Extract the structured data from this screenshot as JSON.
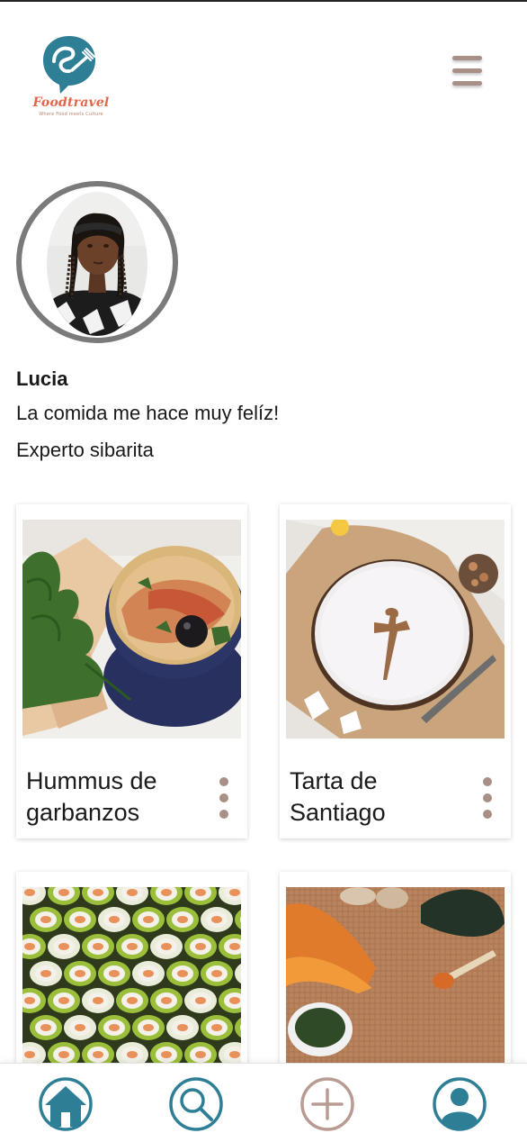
{
  "app": {
    "logo_name": "Foodtravel",
    "logo_tagline": "Where Food meets Culture"
  },
  "header": {
    "menu_icon": "hamburger-menu-icon"
  },
  "profile": {
    "name": "Lucia",
    "bio": "La comida me hace muy felíz!",
    "title": "Experto sibarita"
  },
  "recipes": [
    {
      "title": "Hummus de garbanzos",
      "image": "hummus-photo"
    },
    {
      "title": "Tarta de Santiago",
      "image": "tarta-de-santiago-photo"
    },
    {
      "title": "",
      "image": "sushi-photo"
    },
    {
      "title": "",
      "image": "lentil-soup-photo"
    }
  ],
  "bottom_nav": {
    "items": [
      {
        "icon": "home-icon",
        "active": true
      },
      {
        "icon": "search-icon",
        "active": false
      },
      {
        "icon": "add-icon",
        "active": false
      },
      {
        "icon": "profile-icon",
        "active": false
      }
    ]
  },
  "colors": {
    "brand_teal": "#2e7f95",
    "brand_coral": "#e2674a",
    "accent_taupe": "#a99087",
    "add_button": "#b89b92",
    "avatar_ring": "#7a7a7a"
  }
}
